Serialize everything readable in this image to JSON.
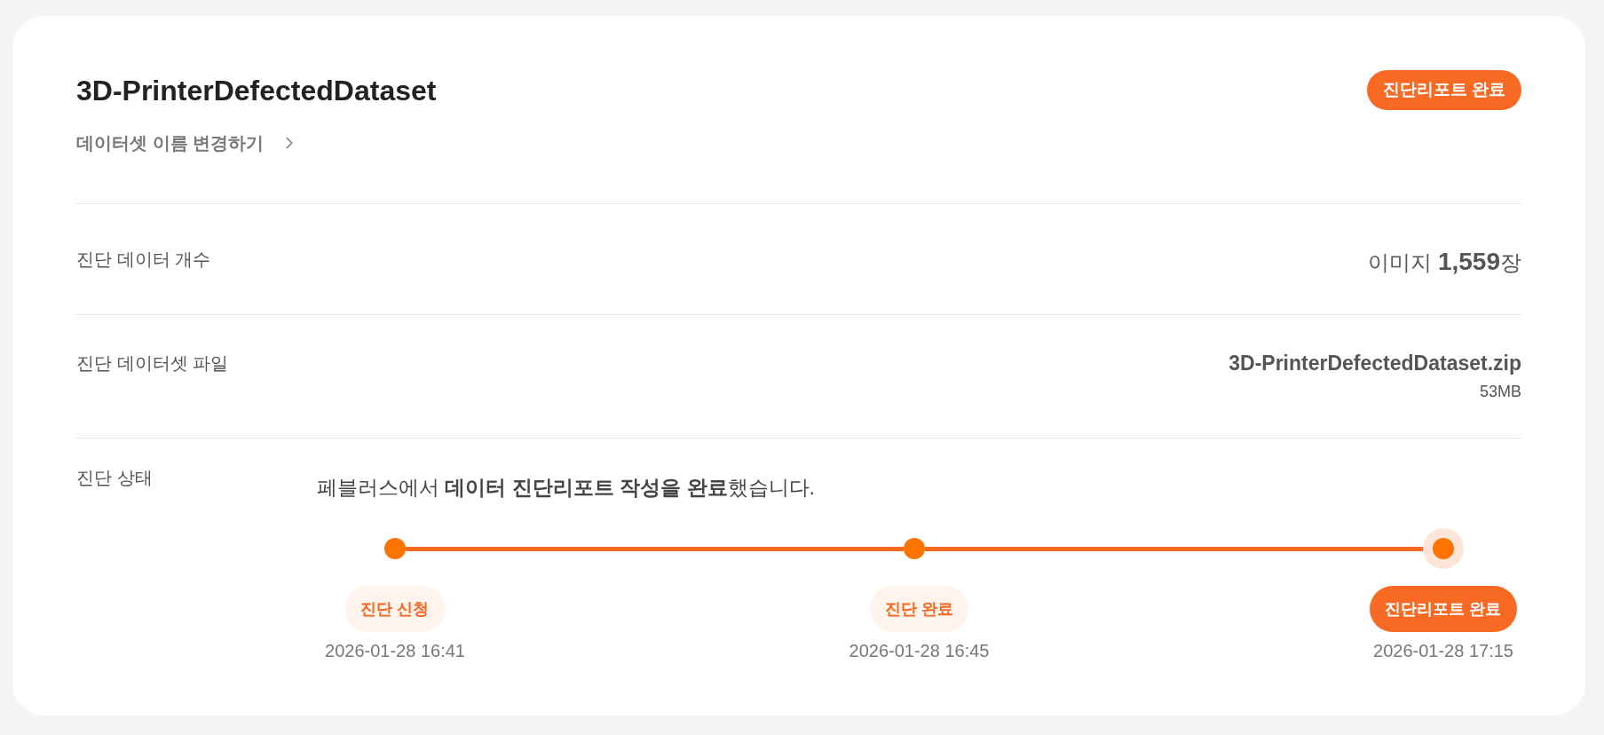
{
  "dataset": {
    "title": "3D-PrinterDefectedDataset",
    "rename_link": "데이터셋 이름 변경하기",
    "status_badge": "진단리포트 완료"
  },
  "rows": [
    {
      "kind": "count",
      "label": "진단 데이터 개수",
      "value": "이미지 **1,559**장"
    },
    {
      "kind": "file",
      "label": "진단 데이터셋 파일",
      "file_name": "3D-PrinterDefectedDataset.zip",
      "file_size": "53MB"
    },
    {
      "kind": "status",
      "label": "진단 상태",
      "message": "페블러스에서 **데이터 진단리포트 작성을 완료**했습니다.",
      "steps": [
        {
          "label": "진단 신청",
          "time": "2026-01-28 16:41",
          "current": false
        },
        {
          "label": "진단 완료",
          "time": "2026-01-28 16:45",
          "current": false
        },
        {
          "label": "진단리포트 완료",
          "time": "2026-01-28 17:15",
          "current": true
        }
      ]
    }
  ]
}
